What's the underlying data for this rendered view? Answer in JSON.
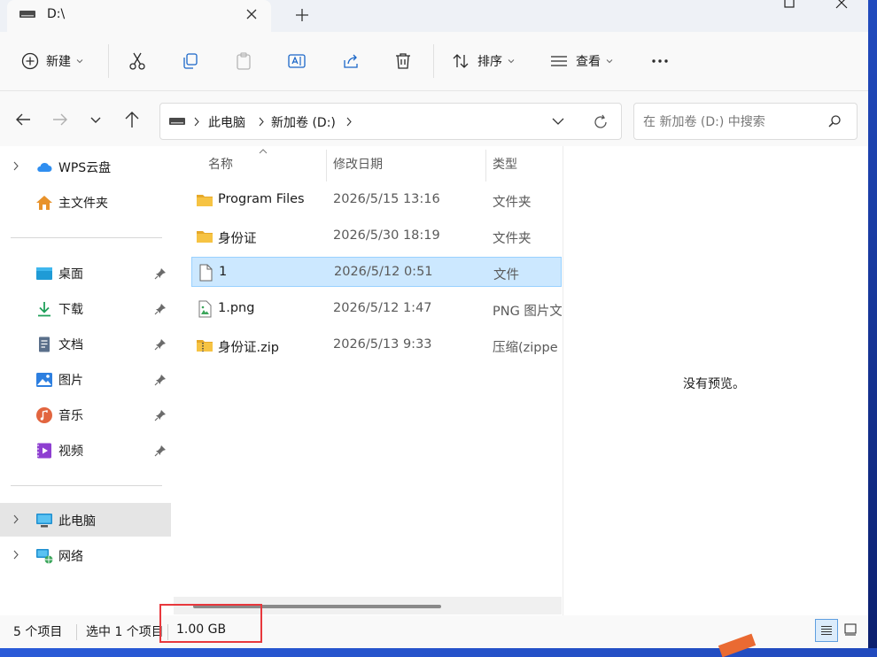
{
  "window": {
    "tab_title": "D:\\"
  },
  "toolbar": {
    "new_label": "新建",
    "sort_label": "排序",
    "view_label": "查看"
  },
  "address": {
    "crumbs": [
      "此电脑",
      "新加卷 (D:)"
    ],
    "search_placeholder": "在 新加卷 (D:) 中搜索"
  },
  "sidebar": {
    "top": [
      {
        "label": "WPS云盘",
        "icon": "cloud-icon"
      },
      {
        "label": "主文件夹",
        "icon": "home-icon"
      }
    ],
    "pinned": [
      {
        "label": "桌面",
        "icon": "desktop-icon"
      },
      {
        "label": "下载",
        "icon": "download-icon"
      },
      {
        "label": "文档",
        "icon": "document-icon"
      },
      {
        "label": "图片",
        "icon": "pictures-icon"
      },
      {
        "label": "音乐",
        "icon": "music-icon"
      },
      {
        "label": "视频",
        "icon": "video-icon"
      }
    ],
    "bottom": [
      {
        "label": "此电脑",
        "icon": "computer-icon",
        "selected": true
      },
      {
        "label": "网络",
        "icon": "network-icon"
      }
    ]
  },
  "filelist": {
    "columns": {
      "name": "名称",
      "date": "修改日期",
      "type": "类型"
    },
    "rows": [
      {
        "name": "Program Files",
        "date": "2026/5/15 13:16",
        "type": "文件夹",
        "icon": "folder-icon"
      },
      {
        "name": "身份证",
        "date": "2026/5/30 18:19",
        "type": "文件夹",
        "icon": "folder-icon"
      },
      {
        "name": "1",
        "date": "2026/5/12 0:51",
        "type": "文件",
        "icon": "file-icon",
        "selected": true
      },
      {
        "name": "1.png",
        "date": "2026/5/12 1:47",
        "type": "PNG 图片文",
        "icon": "image-file-icon"
      },
      {
        "name": "身份证.zip",
        "date": "2026/5/13 9:33",
        "type": "压缩(zippe",
        "icon": "zip-folder-icon"
      }
    ]
  },
  "preview": {
    "message": "没有预览。"
  },
  "status": {
    "item_count": "5 个项目",
    "selected_count": "选中 1 个项目",
    "selected_size": "1.00 GB"
  },
  "colors": {
    "selection_bg": "#cce8ff",
    "highlight_border": "#e8383d",
    "folder_yellow": "#f6c343"
  }
}
